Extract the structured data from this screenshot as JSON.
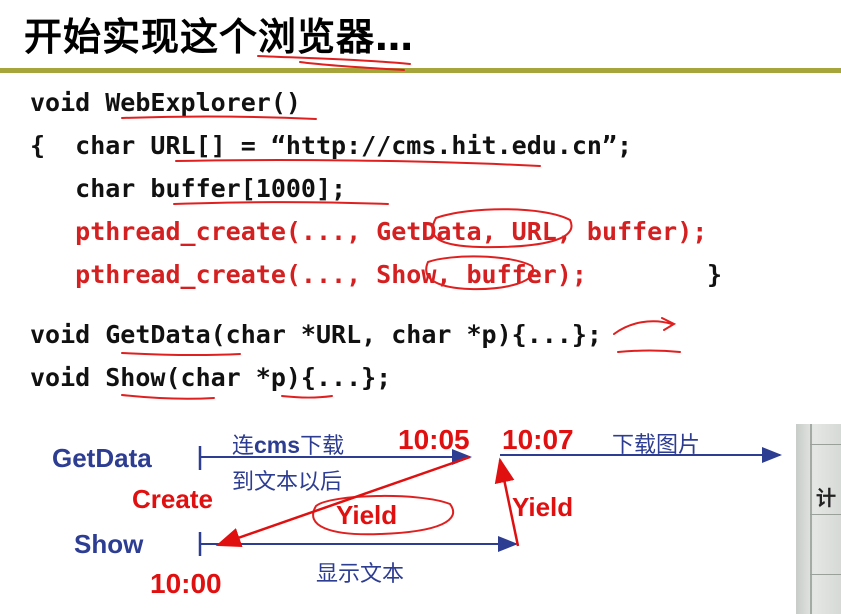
{
  "slide": {
    "title": "开始实现这个浏览器…",
    "code": {
      "line1": "void WebExplorer()",
      "line2": "{  char URL[] = “http://cms.hit.edu.cn”;",
      "line3": "   char buffer[1000];",
      "line4": "   pthread_create(..., GetData, URL, buffer);",
      "line5a": "   pthread_create(..., Show, buffer);",
      "line5b": " }",
      "line6": "void GetData(char *URL, char *p){...};",
      "line7": "void Show(char *p){...};"
    },
    "diagram": {
      "getdata_label": "GetData",
      "show_label": "Show",
      "create_label": "Create",
      "yield_left": "Yield",
      "yield_right": "Yield",
      "time_start": "10:00",
      "time_mid": "10:05",
      "time_end": "10:07",
      "note_connect_prefix": "连",
      "note_connect_cms": "cms",
      "note_connect_suffix": "下载",
      "note_after_text": "到文本以后",
      "note_download_images": "下载图片",
      "note_show_text": "显示文本"
    },
    "photo_glyph": "计"
  },
  "colors": {
    "blue": "#2d3d92",
    "red": "#e01010",
    "code_red": "#d42020",
    "rule": "#a5a53b"
  }
}
